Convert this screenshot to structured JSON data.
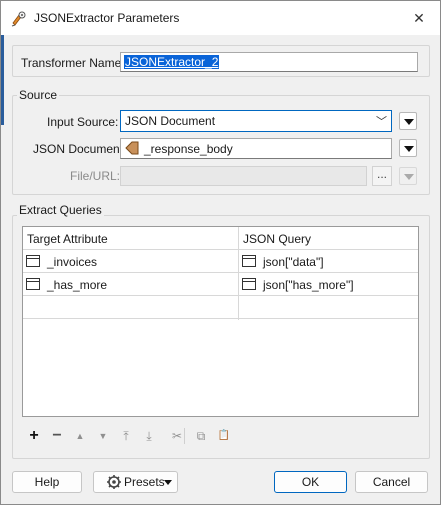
{
  "window": {
    "title": "JSONExtractor Parameters",
    "close_symbol": "✕"
  },
  "transformer": {
    "label": "Transformer Name:",
    "value": "JSONExtractor_2"
  },
  "source": {
    "group_title": "Source",
    "input_source_label": "Input Source:",
    "input_source_value": "JSON Document",
    "json_document_label": "JSON Document:",
    "json_document_value": "_response_body",
    "file_url_label": "File/URL:",
    "file_url_value": "",
    "browse_label": "..."
  },
  "extract_queries": {
    "group_title": "Extract Queries",
    "columns": [
      "Target Attribute",
      "JSON Query"
    ],
    "rows": [
      {
        "target_attribute": "_invoices",
        "json_query": "json[\"data\"]"
      },
      {
        "target_attribute": "_has_more",
        "json_query": "json[\"has_more\"]"
      }
    ]
  },
  "toolbar": {
    "add": "+",
    "remove": "−",
    "move_up": "▲",
    "move_down": "▼",
    "move_top": "⤒",
    "move_bottom": "⤓",
    "cut": "✂",
    "copy": "⧉",
    "paste": "📋"
  },
  "buttons": {
    "help": "Help",
    "presets": "Presets",
    "ok": "OK",
    "cancel": "Cancel"
  },
  "colors": {
    "accent": "#0067c0",
    "selection": "#0a64d8",
    "window_bg": "#f0f0f0",
    "border": "#d5d5d5"
  }
}
